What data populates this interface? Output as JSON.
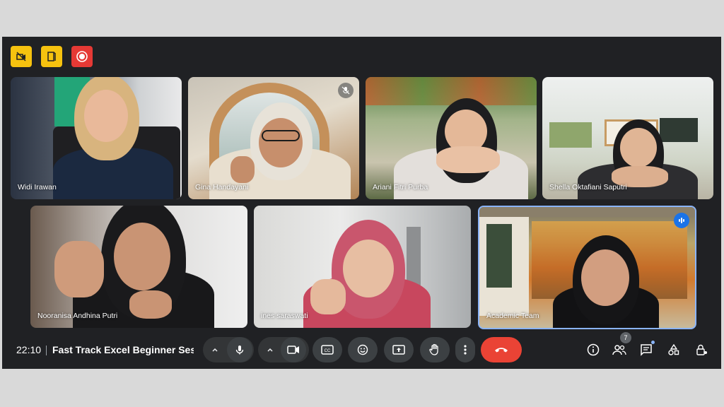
{
  "participants": [
    {
      "name": "Widi Irawan"
    },
    {
      "name": "Gina Handayani"
    },
    {
      "name": "Ariani Fitri Purba"
    },
    {
      "name": "Shella Oktafiani Saputri"
    },
    {
      "name": "Nooranisa Andhina Putri"
    },
    {
      "name": "ines saraswati"
    },
    {
      "name": "Academic Team"
    }
  ],
  "bottom_bar": {
    "time": "22:10",
    "meeting_title": "Fast Track Excel Beginner Sessi...",
    "people_count": "7"
  },
  "colors": {
    "background": "#202124",
    "end_call": "#ea4335",
    "active_speaker": "#1a73e8",
    "notice_yellow": "#f6c20f",
    "recording_red": "#e53935"
  },
  "icons": [
    "camera-off-icon",
    "door-icon",
    "record-icon",
    "mic-off-icon",
    "speaking-icon",
    "chevron-up-icon",
    "mic-icon",
    "camera-icon",
    "captions-icon",
    "emoji-icon",
    "present-icon",
    "raise-hand-icon",
    "more-options-icon",
    "end-call-icon",
    "info-icon",
    "people-icon",
    "chat-icon",
    "activities-icon",
    "host-controls-icon"
  ]
}
